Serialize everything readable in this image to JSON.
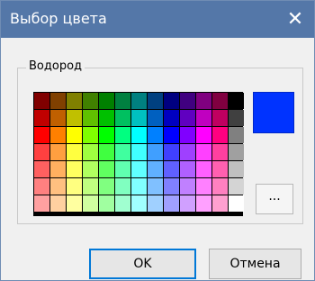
{
  "window": {
    "title": "Выбор цвета",
    "close_symbol": "✕"
  },
  "group": {
    "label": "Водород"
  },
  "palette": {
    "rows": [
      [
        "#800000",
        "#804000",
        "#808000",
        "#408000",
        "#008000",
        "#008040",
        "#008080",
        "#004080",
        "#000080",
        "#400080",
        "#800080",
        "#800040",
        "#000000"
      ],
      [
        "#c00000",
        "#c06000",
        "#c0c000",
        "#60c000",
        "#00c000",
        "#00c060",
        "#00c0c0",
        "#0060c0",
        "#0000c0",
        "#6000c0",
        "#c000c0",
        "#c00060",
        "#404040"
      ],
      [
        "#ff0000",
        "#ff8000",
        "#ffff00",
        "#80ff00",
        "#00ff00",
        "#00ff80",
        "#00ffff",
        "#0080ff",
        "#0000ff",
        "#8000ff",
        "#ff00ff",
        "#ff0080",
        "#808080"
      ],
      [
        "#ff4040",
        "#ff9f40",
        "#ffff40",
        "#9fff40",
        "#40ff40",
        "#40ff9f",
        "#40ffff",
        "#409fff",
        "#4040ff",
        "#9f40ff",
        "#ff40ff",
        "#ff409f",
        "#a0a0a0"
      ],
      [
        "#ff6060",
        "#ffb060",
        "#ffff60",
        "#b0ff60",
        "#60ff60",
        "#60ffb0",
        "#60ffff",
        "#60b0ff",
        "#6060ff",
        "#b060ff",
        "#ff60ff",
        "#ff60b0",
        "#c0c0c0"
      ],
      [
        "#ff8080",
        "#ffc080",
        "#ffff80",
        "#c0ff80",
        "#80ff80",
        "#80ffc0",
        "#80ffff",
        "#80c0ff",
        "#8080ff",
        "#c080ff",
        "#ff80ff",
        "#ff80c0",
        "#d4d4d4"
      ],
      [
        "#ffa0a0",
        "#ffd0a0",
        "#ffffa0",
        "#d0ffa0",
        "#a0ffa0",
        "#a0ffd0",
        "#a0ffff",
        "#a0d0ff",
        "#a0a0ff",
        "#d0a0ff",
        "#ffa0ff",
        "#ffa0d0",
        "#ffffff"
      ]
    ]
  },
  "selected_color": "#0033ff",
  "more_button": {
    "label": "..."
  },
  "buttons": {
    "ok": "OK",
    "cancel": "Отмена"
  }
}
